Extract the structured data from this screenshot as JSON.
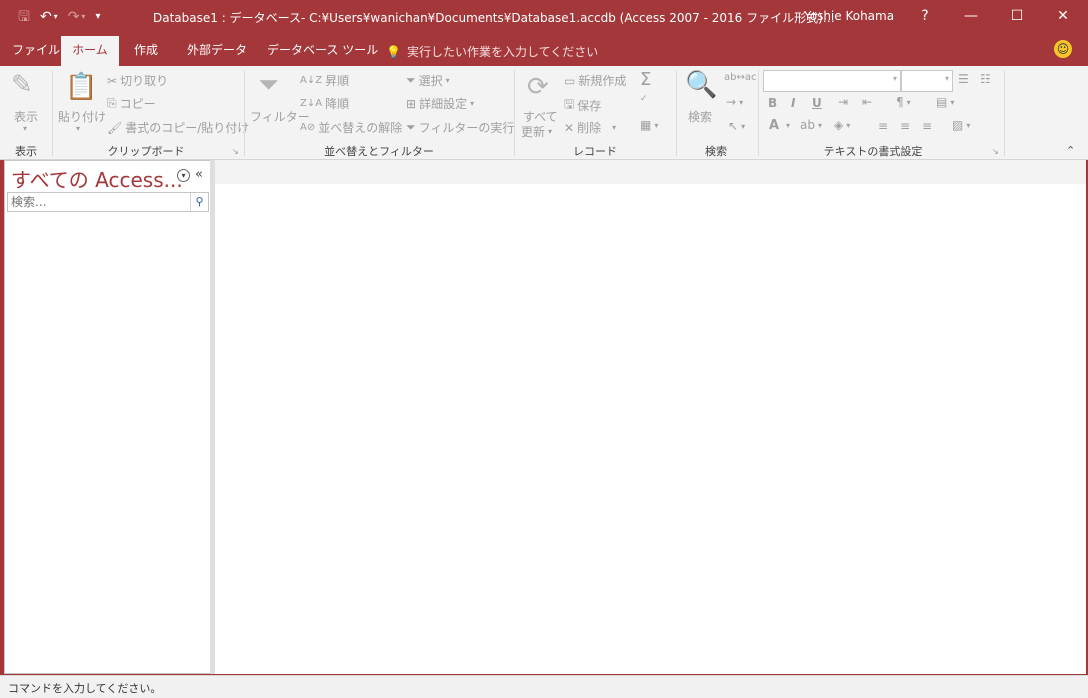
{
  "window": {
    "title": "Database1 : データベース- C:¥Users¥wanichan¥Documents¥Database1.accdb (Access 2007 - 2016 ファイル形式)…",
    "user": "Yoshie Kohama",
    "help": "?",
    "minimize": "—",
    "maximize": "☐",
    "close": "✕"
  },
  "qat": {
    "save": "🖫",
    "undo": "↶",
    "redo": "↷",
    "customize": "▾"
  },
  "tabs": [
    {
      "label": "ファイル"
    },
    {
      "label": "ホーム"
    },
    {
      "label": "作成"
    },
    {
      "label": "外部データ"
    },
    {
      "label": "データベース ツール"
    }
  ],
  "tell_me": "実行したい作業を入力してください",
  "ribbon": {
    "view": {
      "label": "表示",
      "group": "表示"
    },
    "clipboard": {
      "paste": "貼り付け",
      "cut": "切り取り",
      "copy": "コピー",
      "format_painter": "書式のコピー/貼り付け",
      "group": "クリップボード"
    },
    "sort_filter": {
      "filter": "フィルター",
      "ascending": "昇順",
      "descending": "降順",
      "remove_sort": "並べ替えの解除",
      "selection": "選択",
      "advanced": "詳細設定",
      "toggle_filter": "フィルターの実行",
      "group": "並べ替えとフィルター"
    },
    "records": {
      "refresh_line1": "すべて",
      "refresh_line2": "更新",
      "new": "新規作成",
      "save": "保存",
      "delete": "削除",
      "group": "レコード"
    },
    "find": {
      "find": "検索",
      "group": "検索"
    },
    "text_formatting": {
      "bold": "B",
      "italic": "I",
      "underline": "U",
      "font_color": "A",
      "group": "テキストの書式設定"
    }
  },
  "nav": {
    "title": "すべての Access...",
    "search_placeholder": "検索...",
    "collapse": "«"
  },
  "status": {
    "text": "コマンドを入力してください。"
  }
}
